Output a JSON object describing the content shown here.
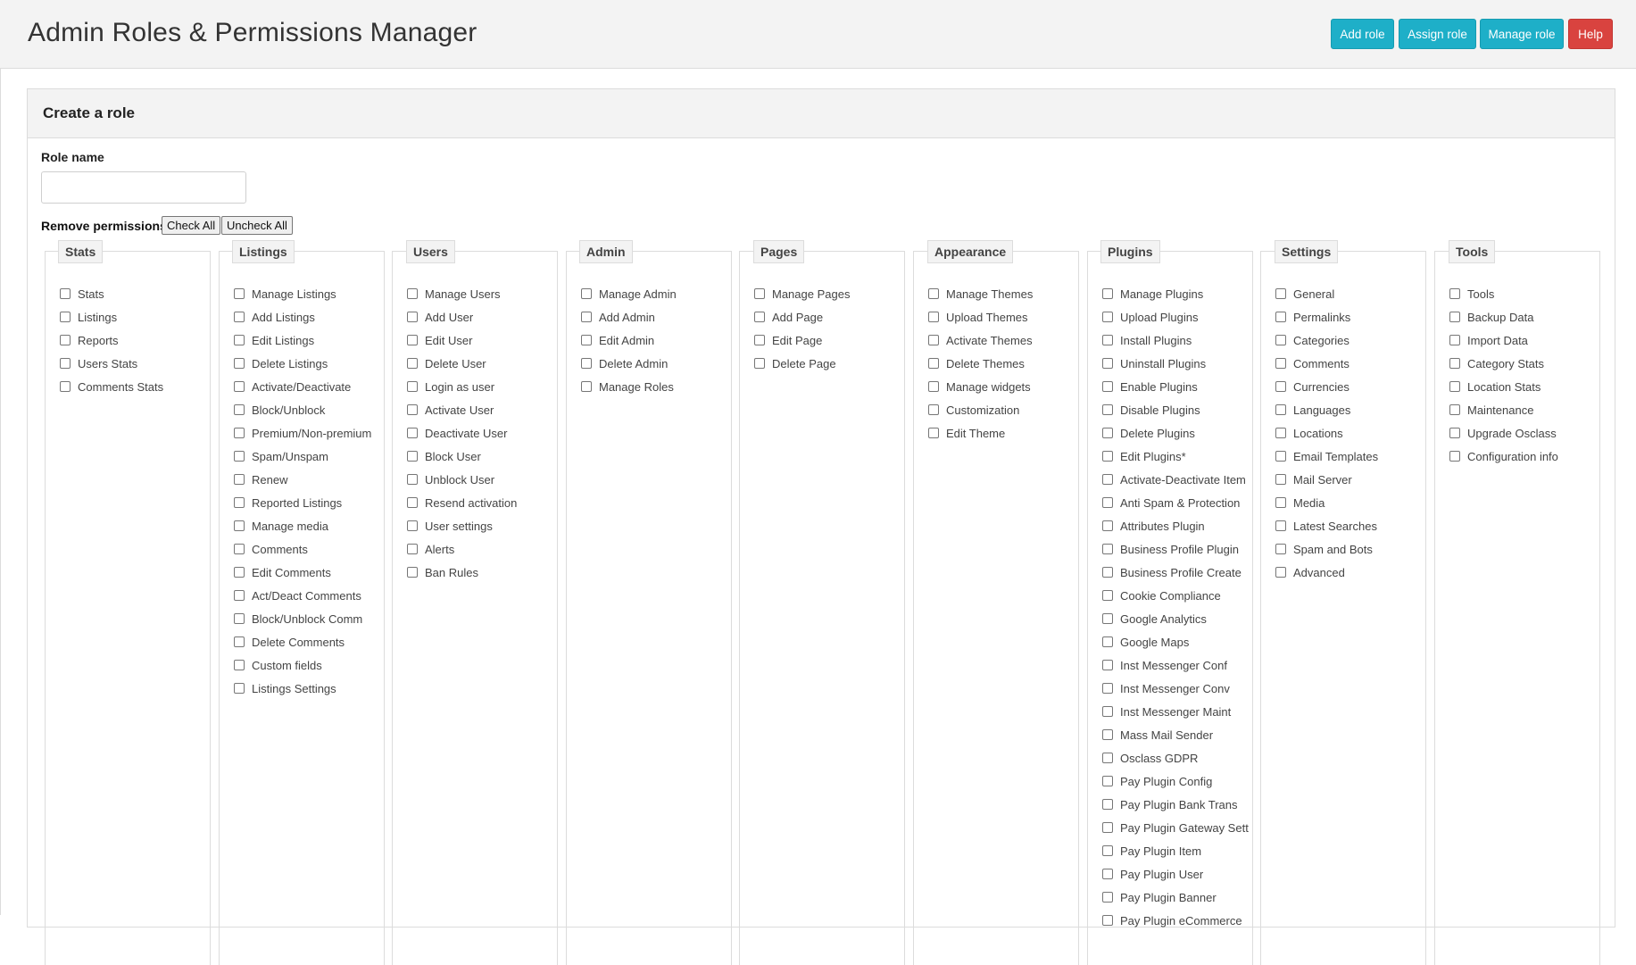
{
  "header": {
    "title": "Admin Roles & Permissions Manager",
    "buttons": [
      {
        "label": "Add role"
      },
      {
        "label": "Assign role"
      },
      {
        "label": "Manage role"
      },
      {
        "label": "Help"
      }
    ]
  },
  "panel": {
    "title": "Create a role",
    "role_name_label": "Role name",
    "role_name_value": "",
    "permissions_label": "Remove permissions",
    "check_all_label": "Check All",
    "uncheck_all_label": "Uncheck All"
  },
  "groups": [
    {
      "title": "Stats",
      "items": [
        "Stats",
        "Listings",
        "Reports",
        "Users Stats",
        "Comments Stats"
      ]
    },
    {
      "title": "Listings",
      "items": [
        "Manage Listings",
        "Add Listings",
        "Edit Listings",
        "Delete Listings",
        "Activate/Deactivate",
        "Block/Unblock",
        "Premium/Non-premium",
        "Spam/Unspam",
        "Renew",
        "Reported Listings",
        "Manage media",
        "Comments",
        "Edit Comments",
        "Act/Deact Comments",
        "Block/Unblock Comm",
        "Delete Comments",
        "Custom fields",
        "Listings Settings"
      ]
    },
    {
      "title": "Users",
      "items": [
        "Manage Users",
        "Add User",
        "Edit User",
        "Delete User",
        "Login as user",
        "Activate User",
        "Deactivate User",
        "Block User",
        "Unblock User",
        "Resend activation",
        "User settings",
        "Alerts",
        "Ban Rules"
      ]
    },
    {
      "title": "Admin",
      "items": [
        "Manage Admin",
        "Add Admin",
        "Edit Admin",
        "Delete Admin",
        "Manage Roles"
      ]
    },
    {
      "title": "Pages",
      "items": [
        "Manage Pages",
        "Add Page",
        "Edit Page",
        "Delete Page"
      ]
    },
    {
      "title": "Appearance",
      "items": [
        "Manage Themes",
        "Upload Themes",
        "Activate Themes",
        "Delete Themes",
        "Manage widgets",
        "Customization",
        "Edit Theme"
      ]
    },
    {
      "title": "Plugins",
      "items": [
        "Manage Plugins",
        "Upload Plugins",
        "Install Plugins",
        "Uninstall Plugins",
        "Enable Plugins",
        "Disable Plugins",
        "Delete Plugins",
        "Edit Plugins*",
        "Activate-Deactivate Item",
        "Anti Spam & Protection",
        "Attributes Plugin",
        "Business Profile Plugin",
        "Business Profile Create",
        "Cookie Compliance",
        "Google Analytics",
        "Google Maps",
        "Inst Messenger Conf",
        "Inst Messenger Conv",
        "Inst Messenger Maint",
        "Mass Mail Sender",
        "Osclass GDPR",
        "Pay Plugin Config",
        "Pay Plugin Bank Trans",
        "Pay Plugin Gateway Sett",
        "Pay Plugin Item",
        "Pay Plugin User",
        "Pay Plugin Banner",
        "Pay Plugin eCommerce"
      ]
    },
    {
      "title": "Settings",
      "items": [
        "General",
        "Permalinks",
        "Categories",
        "Comments",
        "Currencies",
        "Languages",
        "Locations",
        "Email Templates",
        "Mail Server",
        "Media",
        "Latest Searches",
        "Spam and Bots",
        "Advanced"
      ]
    },
    {
      "title": "Tools",
      "items": [
        "Tools",
        "Backup Data",
        "Import Data",
        "Category Stats",
        "Location Stats",
        "Maintenance",
        "Upgrade Osclass",
        "Configuration info"
      ]
    }
  ]
}
